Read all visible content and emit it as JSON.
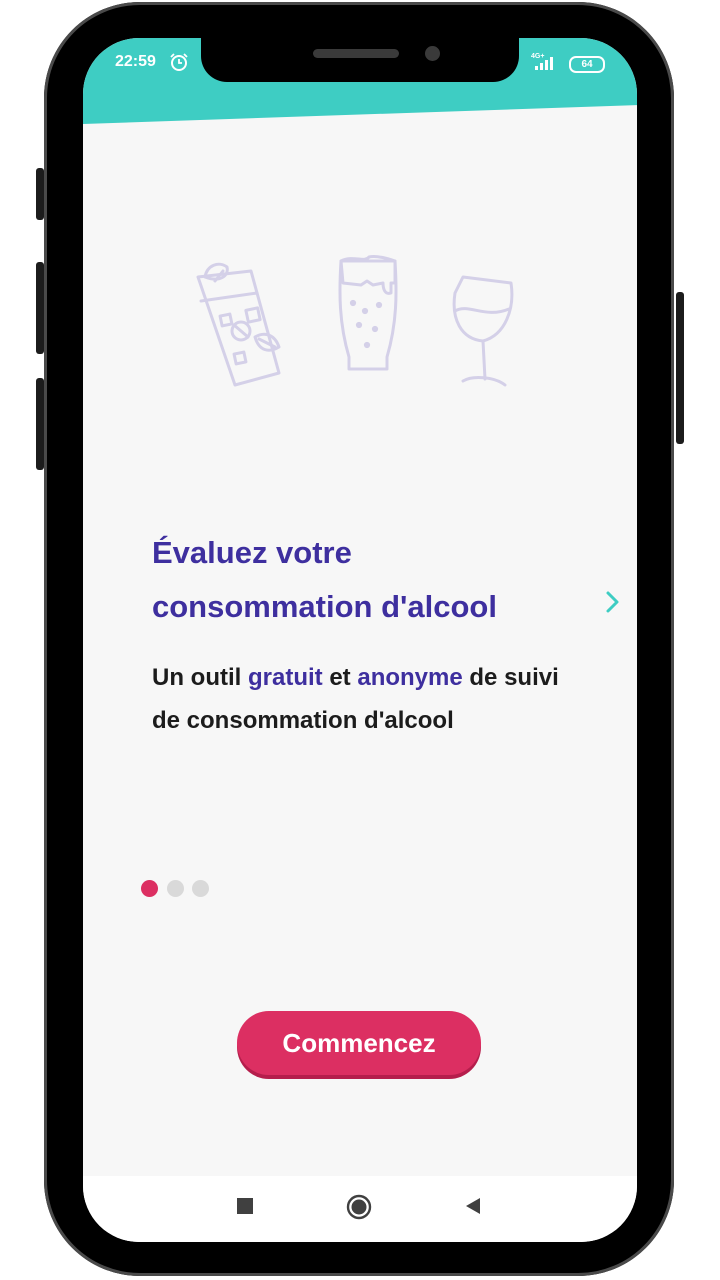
{
  "status_bar": {
    "time": "22:59",
    "network": "4G+",
    "battery": "64"
  },
  "onboarding": {
    "title_line1": "Évaluez votre",
    "title_line2": "consommation d'alcool",
    "subtitle_part1": "Un outil ",
    "subtitle_highlight1": "gratuit",
    "subtitle_part2": " et ",
    "subtitle_highlight2": "anonyme",
    "subtitle_part3": " de suivi de consommation d'alcool",
    "page_count": 3,
    "current_page": 1,
    "illustration_icons": [
      "cocktail-icon",
      "beer-icon",
      "wine-glass-icon"
    ]
  },
  "actions": {
    "start_label": "Commencez",
    "next_icon": "chevron-right-icon"
  },
  "navigation_bar": {
    "icons": [
      "recent-apps-icon",
      "home-icon",
      "back-icon"
    ]
  },
  "colors": {
    "header": "#3ecdc3",
    "accent_text": "#3e2f9f",
    "button": "#dc2f62",
    "active_dot": "#dc2f62",
    "illustration": "#d4d0e8"
  }
}
